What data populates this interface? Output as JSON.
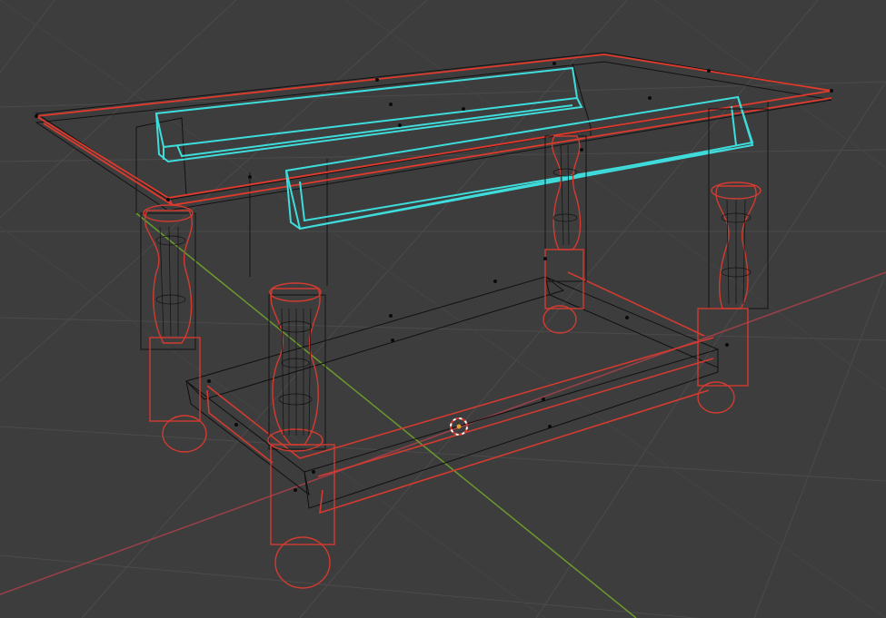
{
  "viewport": {
    "mode": "wireframe",
    "shading": "wireframe",
    "selection": {
      "active_color": "#3fdcdc",
      "selected_color": "#e8352a",
      "unselected_color": "#121212"
    },
    "colors": {
      "background": "#3d3d3d",
      "grid": "#4a4a4a",
      "x_axis": "#b3484e",
      "y_axis": "#6f9a2c",
      "cursor_ring": "#ffffff",
      "cursor_center": "#e0a030"
    },
    "scene": {
      "object": "table",
      "legs": 4,
      "top_rails": 2,
      "stretchers": 4
    }
  }
}
